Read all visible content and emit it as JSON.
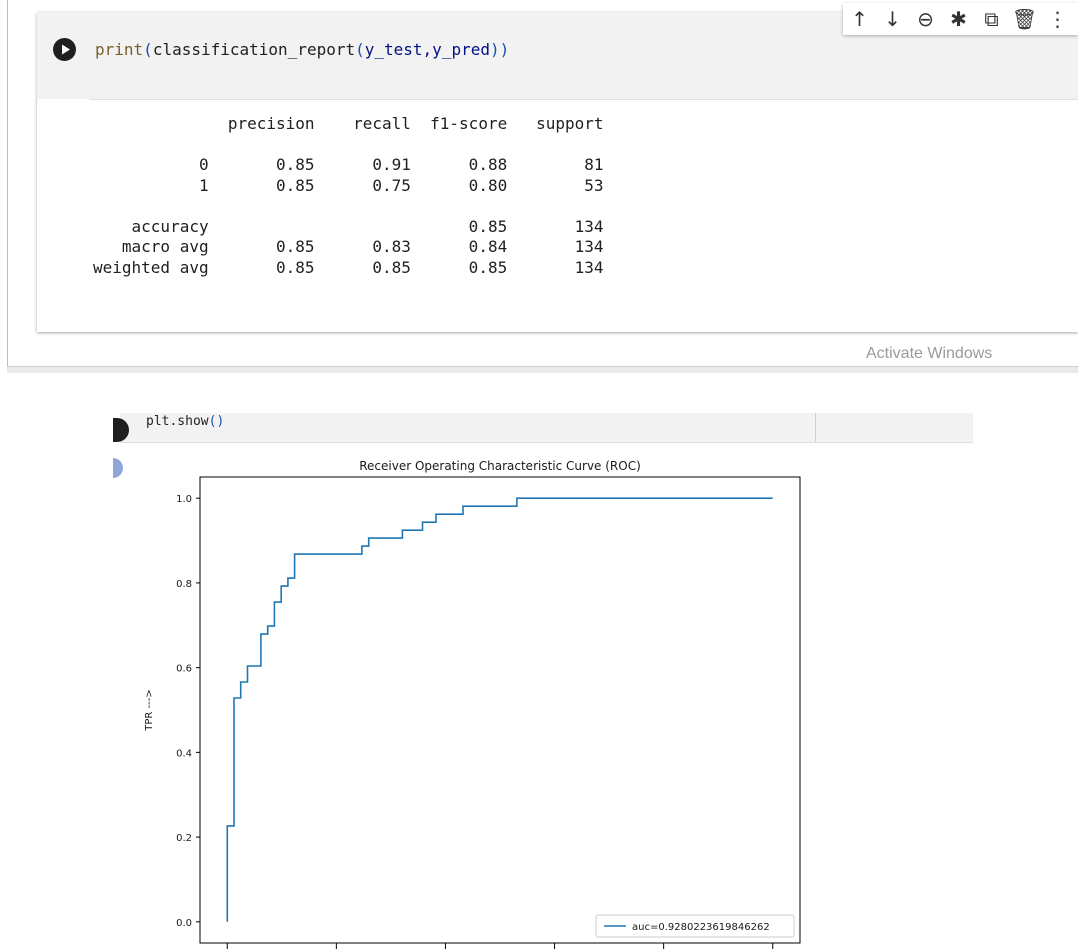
{
  "cell1": {
    "code": {
      "fn": "print",
      "open": "(",
      "fn2": "classification_report",
      "open2": "(",
      "args": "y_test,y_pred",
      "close": "))"
    },
    "report_lines": [
      "              precision    recall  f1-score   support",
      "",
      "           0       0.85      0.91      0.88        81",
      "           1       0.85      0.75      0.80        53",
      "",
      "    accuracy                           0.85       134",
      "   macro avg       0.85      0.83      0.84       134",
      "weighted avg       0.85      0.85      0.85       134"
    ]
  },
  "toolbar": {
    "move_up": "↑",
    "move_down": "↓",
    "link": "⊖",
    "settings": "✱",
    "mirror": "⧉",
    "delete": "🗑",
    "more": "⋮"
  },
  "watermark": "Activate Windows",
  "cell2": {
    "code": "plt.show",
    "code_parens": "()"
  },
  "chart_data": {
    "type": "line",
    "title": "Receiver Operating Characteristic Curve (ROC)",
    "xlabel": "",
    "ylabel": "TPR --->",
    "xlim": [
      -0.05,
      1.05
    ],
    "ylim": [
      -0.05,
      1.05
    ],
    "yticks": [
      "0.0",
      "0.2",
      "0.4",
      "0.6",
      "0.8",
      "1.0"
    ],
    "grid": false,
    "legend_placement": "lower-right",
    "series": [
      {
        "name": "auc=0.9280223619846262",
        "color": "#1f77b4",
        "fpr": [
          0.0,
          0.0,
          0.0123,
          0.0123,
          0.0123,
          0.0247,
          0.0247,
          0.037,
          0.037,
          0.0617,
          0.0617,
          0.0741,
          0.0741,
          0.0864,
          0.0864,
          0.0988,
          0.0988,
          0.1111,
          0.1111,
          0.1235,
          0.1235,
          0.2469,
          0.2469,
          0.2593,
          0.2593,
          0.321,
          0.321,
          0.358,
          0.358,
          0.3827,
          0.3827,
          0.4321,
          0.4321,
          0.5309,
          0.5309,
          1.0
        ],
        "tpr": [
          0.0,
          0.2264,
          0.2264,
          0.5283,
          0.5283,
          0.5283,
          0.566,
          0.566,
          0.6038,
          0.6038,
          0.6792,
          0.6792,
          0.6981,
          0.6981,
          0.7547,
          0.7547,
          0.7925,
          0.7925,
          0.8113,
          0.8113,
          0.8679,
          0.8679,
          0.8868,
          0.8868,
          0.9057,
          0.9057,
          0.9245,
          0.9245,
          0.9434,
          0.9434,
          0.9623,
          0.9623,
          0.9811,
          0.9811,
          1.0,
          1.0
        ]
      }
    ]
  }
}
